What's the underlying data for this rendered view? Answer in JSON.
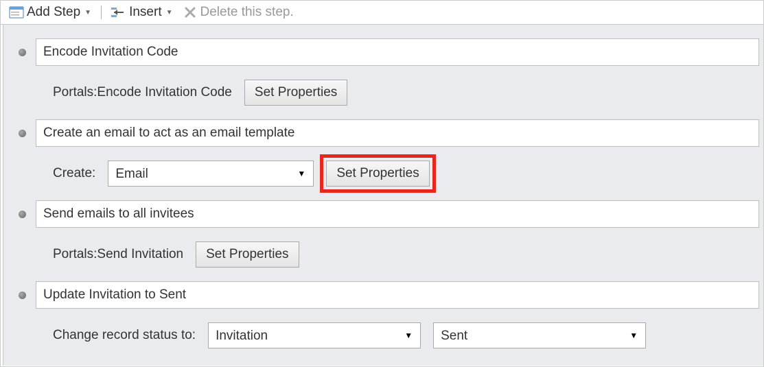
{
  "toolbar": {
    "addStep": "Add Step",
    "insert": "Insert",
    "deleteLabel": "Delete this step."
  },
  "steps": [
    {
      "title": "Encode Invitation Code",
      "detailLabel": "Portals:Encode Invitation Code",
      "setPropertiesLabel": "Set Properties"
    },
    {
      "title": "Create an email to act as an email template",
      "createLabel": "Create:",
      "createValue": "Email",
      "setPropertiesLabel": "Set Properties"
    },
    {
      "title": "Send emails to all invitees",
      "detailLabel": "Portals:Send Invitation",
      "setPropertiesLabel": "Set Properties"
    },
    {
      "title": "Update Invitation to Sent",
      "changeStatusLabel": "Change record status to:",
      "statusEntity": "Invitation",
      "statusValue": "Sent"
    }
  ]
}
